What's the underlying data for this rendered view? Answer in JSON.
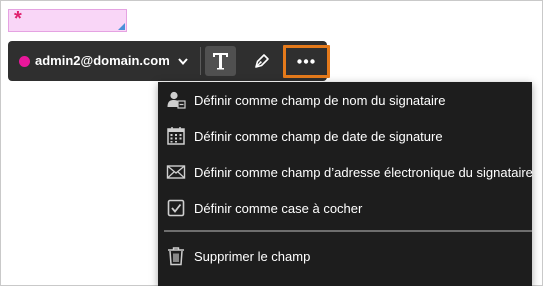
{
  "field": {
    "required_marker": "*"
  },
  "toolbar": {
    "recipient_email": "admin2@domain.com",
    "recipient_color": "#e8179a",
    "tools": [
      "text-tool-icon",
      "pen-icon",
      "more-options-icon"
    ],
    "highlight_color": "#e57a1b"
  },
  "menu": {
    "items": [
      {
        "icon": "signer-name-icon",
        "label": "Définir comme champ de nom du signataire"
      },
      {
        "icon": "calendar-icon",
        "label": "Définir comme champ de date de signature"
      },
      {
        "icon": "envelope-icon",
        "label": "Définir comme champ d’adresse électronique du signataire"
      },
      {
        "icon": "checkbox-icon",
        "label": "Définir comme case à cocher"
      },
      {
        "icon": "trash-icon",
        "label": "Supprimer le champ"
      }
    ]
  }
}
